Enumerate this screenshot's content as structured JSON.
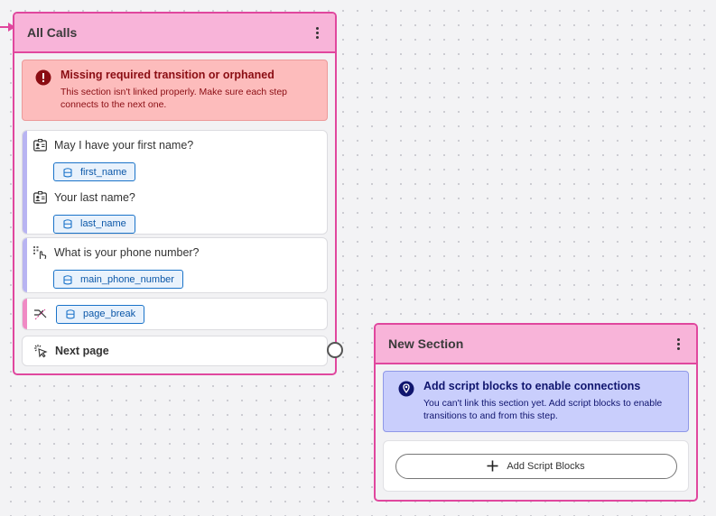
{
  "colors": {
    "section_border": "#e0479e",
    "section_header": "#f8b4d9",
    "error_bg": "#fdbcbc",
    "error_text": "#8a0d13",
    "info_bg": "#c9cefc",
    "info_text": "#10156e",
    "chip_border": "#1a73c9",
    "accent_purple": "#b8b4f2",
    "accent_pink": "#f08ac4"
  },
  "all_calls": {
    "title": "All Calls",
    "menu_icon": "kebab-menu-icon",
    "alert": {
      "icon": "error-circle-icon",
      "title": "Missing required transition or orphaned",
      "body": "This section isn't linked properly. Make sure each step connects to the next one."
    },
    "blocks": [
      {
        "steps": [
          {
            "icon": "contact-card-icon",
            "label": "May I have your first name?",
            "variable": "first_name"
          },
          {
            "icon": "contact-card-icon",
            "label": "Your last name?",
            "variable": "last_name"
          }
        ]
      },
      {
        "steps": [
          {
            "icon": "keypad-touch-icon",
            "label": "What is your phone number?",
            "variable": "main_phone_number"
          }
        ]
      },
      {
        "steps": [
          {
            "icon": "page-break-icon",
            "variable": "page_break"
          }
        ]
      }
    ],
    "variable_icon": "database-icon",
    "next_page": {
      "icon": "click-icon",
      "label": "Next page"
    }
  },
  "new_section": {
    "title": "New Section",
    "menu_icon": "kebab-menu-icon",
    "alert": {
      "icon": "location-pin-icon",
      "title": "Add script blocks to enable connections",
      "body": "You can't link this section yet. Add script blocks to enable transitions to and from this step."
    },
    "add_button": {
      "icon": "plus-icon",
      "label": "Add Script Blocks"
    }
  }
}
